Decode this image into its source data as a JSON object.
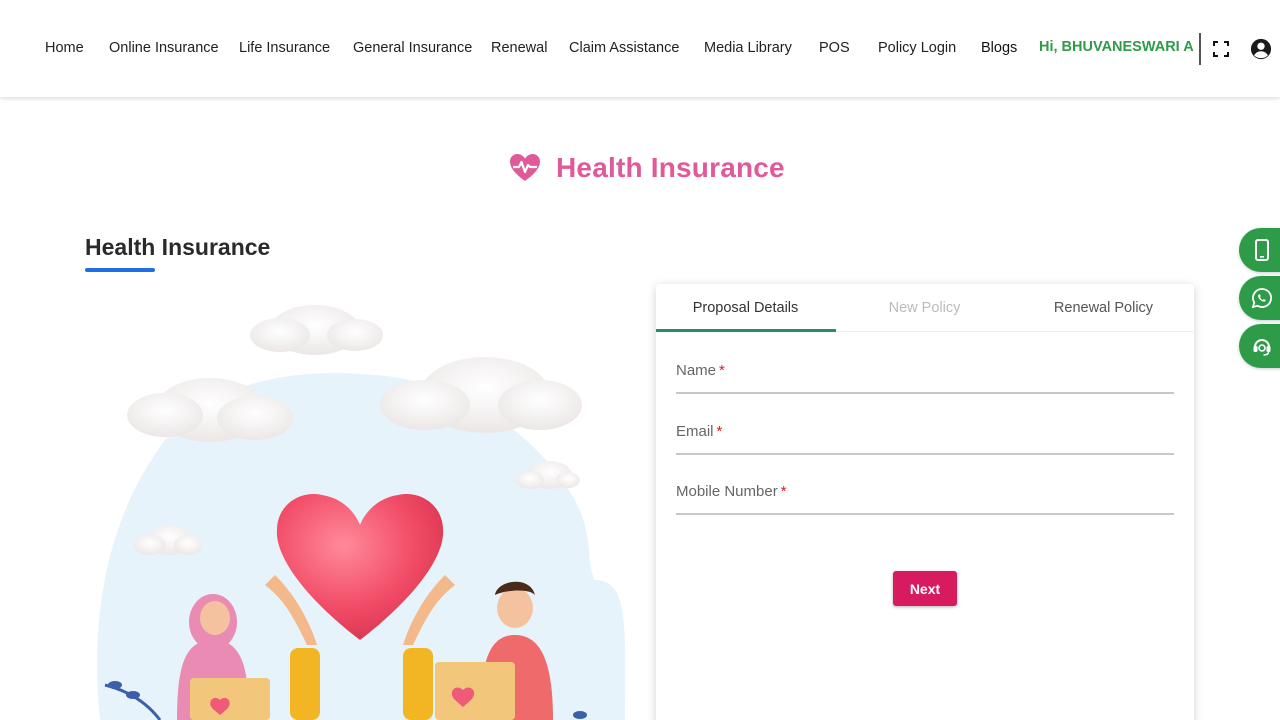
{
  "nav": {
    "items": [
      "Home",
      "Online Insurance",
      "Life Insurance",
      "General Insurance",
      "Renewal",
      "Claim Assistance",
      "Media Library",
      "POS",
      "Policy Login",
      "Blogs"
    ],
    "greeting": "Hi, BHUVANESWARI A"
  },
  "page": {
    "brand_title": "Health Insurance",
    "section_title": "Health Insurance"
  },
  "form": {
    "tabs": [
      "Proposal Details",
      "New Policy",
      "Renewal Policy"
    ],
    "active_tab": "Proposal Details",
    "fields": [
      {
        "label": "Name",
        "required_mark": "*",
        "value": ""
      },
      {
        "label": "Email",
        "required_mark": "*",
        "value": ""
      },
      {
        "label": "Mobile Number",
        "required_mark": "*",
        "value": ""
      }
    ],
    "next_label": "Next"
  },
  "side_buttons": [
    "mobile-icon",
    "whatsapp-icon",
    "support-agent-icon"
  ],
  "colors": {
    "brand_pink": "#e05a9a",
    "button_red": "#d81b60",
    "green": "#2e9b48",
    "underline_blue": "#1f6fe0",
    "tab_indicator": "#2a8a6a"
  }
}
